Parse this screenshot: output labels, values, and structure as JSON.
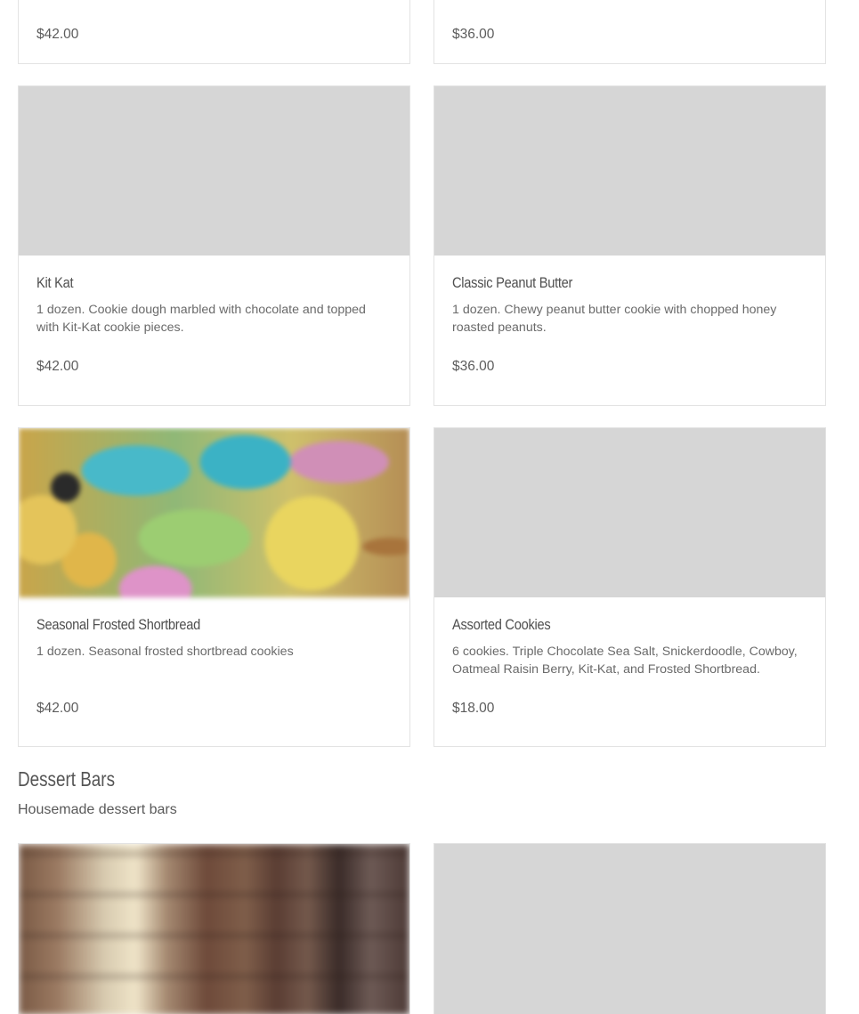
{
  "top_row": [
    {
      "price": "$42.00"
    },
    {
      "price": "$36.00"
    }
  ],
  "cookies": [
    {
      "title": "Kit Kat",
      "description": "1 dozen. Cookie dough marbled with chocolate and topped with Kit-Kat cookie pieces.",
      "price": "$42.00",
      "image": "placeholder"
    },
    {
      "title": "Classic Peanut Butter",
      "description": "1 dozen. Chewy peanut butter cookie with chopped honey roasted peanuts.",
      "price": "$36.00",
      "image": "placeholder"
    },
    {
      "title": "Seasonal Frosted Shortbread",
      "description": "1 dozen. Seasonal frosted shortbread cookies",
      "price": "$42.00",
      "image": "frosted-shortbread-photo"
    },
    {
      "title": "Assorted Cookies",
      "description": "6 cookies. Triple Chocolate Sea Salt, Snickerdoodle, Cowboy, Oatmeal Raisin Berry, Kit-Kat, and Frosted Shortbread.",
      "price": "$18.00",
      "image": "placeholder"
    }
  ],
  "dessert_section": {
    "title": "Dessert Bars",
    "subtitle": "Housemade dessert bars",
    "items": [
      {
        "image": "dessert-bars-photo"
      },
      {
        "image": "placeholder"
      }
    ]
  },
  "colors": {
    "placeholder_gray": "#d6d6d6",
    "card_border": "#e3e3e3",
    "text": "#595959"
  }
}
